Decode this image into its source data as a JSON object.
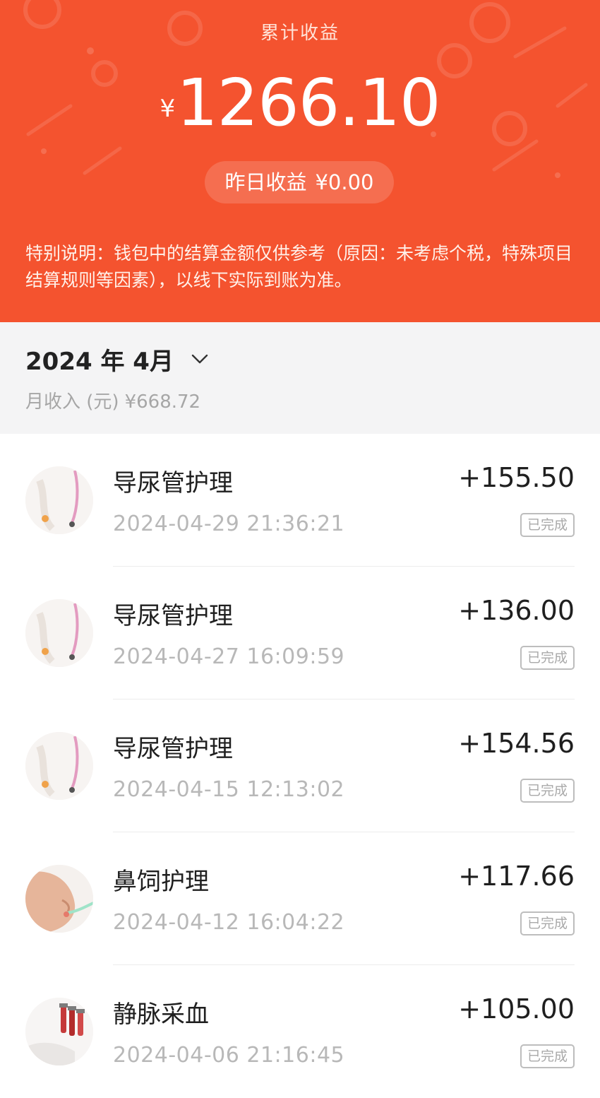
{
  "header": {
    "title": "累计收益",
    "currency_symbol": "¥",
    "total_amount": "1266.10",
    "yesterday_label": "昨日收益",
    "yesterday_value": "¥0.00",
    "notice": "特别说明：钱包中的结算金额仅供参考（原因：未考虑个税，特殊项目结算规则等因素），以线下实际到账为准。"
  },
  "month": {
    "label": "2024 年 4月",
    "income_label": "月收入 (元)",
    "income_value": "¥668.72"
  },
  "transactions": [
    {
      "title": "导尿管护理",
      "amount": "+155.50",
      "datetime": "2024-04-29 21:36:21",
      "status": "已完成",
      "icon": "catheter-icon"
    },
    {
      "title": "导尿管护理",
      "amount": "+136.00",
      "datetime": "2024-04-27 16:09:59",
      "status": "已完成",
      "icon": "catheter-icon"
    },
    {
      "title": "导尿管护理",
      "amount": "+154.56",
      "datetime": "2024-04-15 12:13:02",
      "status": "已完成",
      "icon": "catheter-icon"
    },
    {
      "title": "鼻饲护理",
      "amount": "+117.66",
      "datetime": "2024-04-12 16:04:22",
      "status": "已完成",
      "icon": "nasal-feeding-icon"
    },
    {
      "title": "静脉采血",
      "amount": "+105.00",
      "datetime": "2024-04-06 21:16:45",
      "status": "已完成",
      "icon": "blood-draw-icon"
    }
  ],
  "colors": {
    "header_bg": "#f4532f",
    "text_primary": "#1f1f1f",
    "text_secondary": "#b8b8b8"
  }
}
